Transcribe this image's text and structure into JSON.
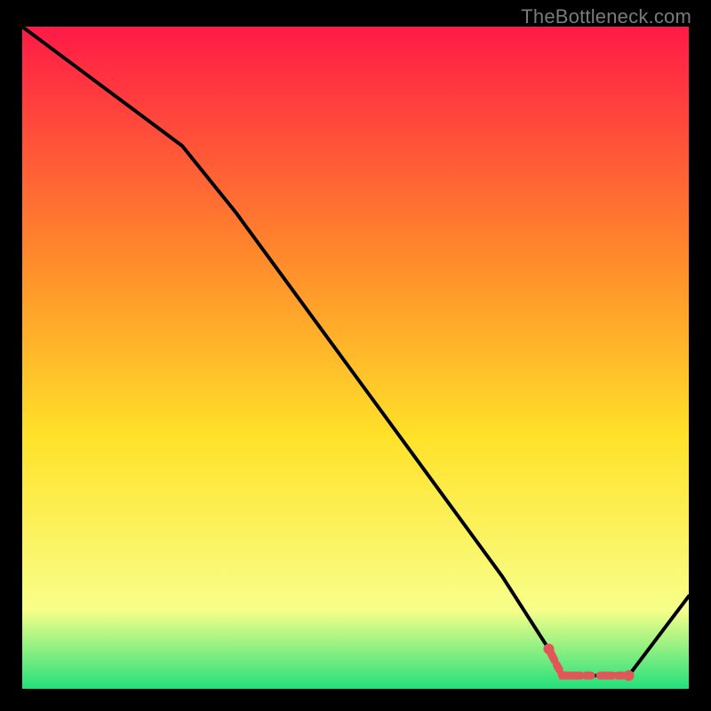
{
  "attribution": "TheBottleneck.com",
  "colors": {
    "background": "#000000",
    "gradient_top": "#ff1a47",
    "gradient_mid1": "#ff8a2b",
    "gradient_mid2": "#ffe229",
    "gradient_mid3": "#f8ff8a",
    "gradient_bottom": "#23e07a",
    "line": "#000000",
    "marker": "#e15759"
  },
  "chart_data": {
    "type": "line",
    "title": "",
    "xlabel": "",
    "ylabel": "",
    "xlim": [
      0,
      100
    ],
    "ylim": [
      0,
      100
    ],
    "x": [
      0,
      8,
      16,
      24,
      32,
      40,
      48,
      56,
      64,
      72,
      79,
      81,
      84,
      87,
      89,
      91,
      100
    ],
    "values": [
      100,
      94,
      88,
      82,
      72,
      61,
      50,
      39,
      28,
      17,
      6,
      2,
      2,
      2,
      2,
      2,
      14
    ],
    "flat_marker_x": [
      79,
      81,
      84,
      87,
      89,
      91
    ],
    "note": "Values estimated from pixel positions; curve descends from top-left, flattens near bottom ~x79–91, then rises; vertical gradient fill from red→orange→yellow→pale→green."
  }
}
